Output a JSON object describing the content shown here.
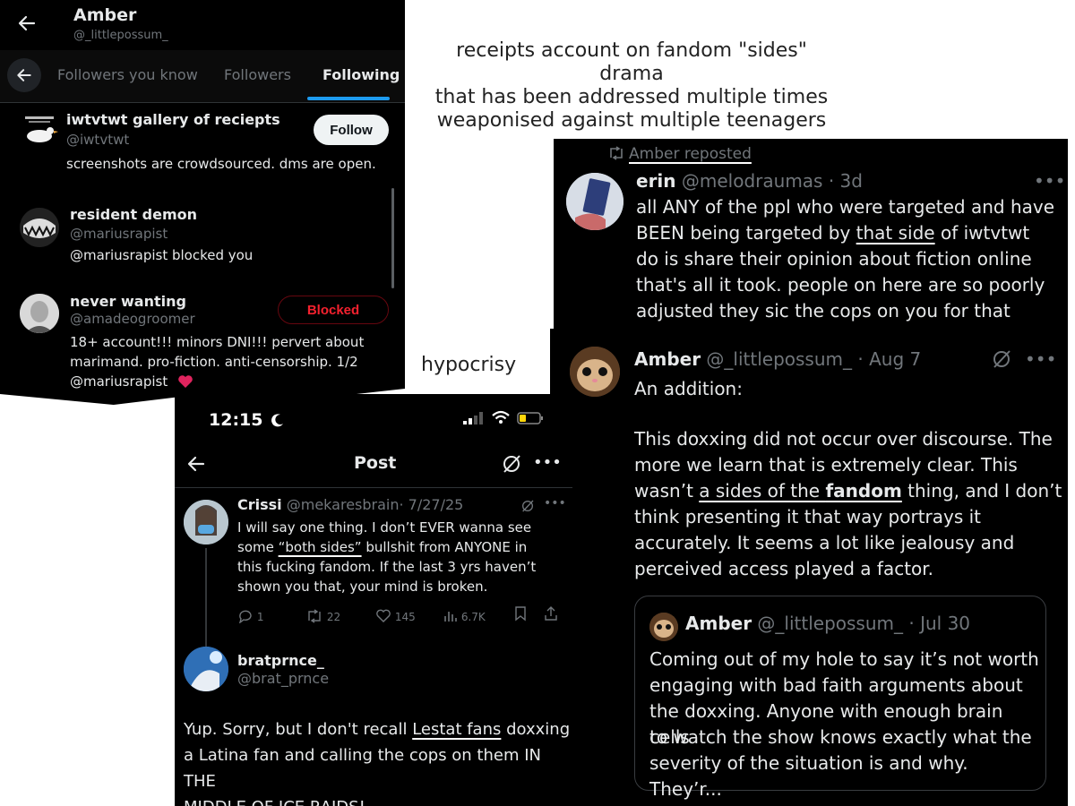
{
  "captions": {
    "top_lines": [
      "receipts account on fandom \"sides\" drama",
      "that has been addressed multiple times",
      "weaponised against multiple teenagers"
    ],
    "middle": "hypocrisy"
  },
  "following_panel": {
    "profile_name": "Amber",
    "profile_handle": "@_littlepossum_",
    "tabs": [
      "Followers you know",
      "Followers",
      "Following"
    ],
    "active_tab": "Following",
    "users": [
      {
        "name": "iwtvtwt gallery of reciepts",
        "handle": "@iwtvtwt",
        "bio": "screenshots are crowdsourced. dms are open.",
        "button": "Follow"
      },
      {
        "name": "resident demon",
        "handle": "@mariusrapist",
        "bio": "@mariusrapist blocked you",
        "button": ""
      },
      {
        "name": "never wanting",
        "handle": "@amadeogroomer",
        "bio_lines": [
          "18+ account!!! minors DNI!!! pervert about",
          "marimand. pro-fiction. anti-censorship. 1/2",
          "@mariusrapist"
        ],
        "button": "Blocked"
      }
    ]
  },
  "repost_panel": {
    "repost_label": "Amber reposted",
    "author": "erin",
    "handle": "@melodraumas",
    "time": "· 3d",
    "text_lines": [
      "all ANY of the ppl who were targeted and have",
      [
        "BEEN being targeted by ",
        "that side",
        " of iwtvtwt"
      ],
      "do is share their opinion about fiction online",
      "that's all it took. people on here are so poorly",
      "adjusted they sic the cops on you for that"
    ]
  },
  "amber_panel": {
    "author": "Amber",
    "handle": "@_littlepossum_",
    "time": "· Aug 7",
    "text_first": "An addition:",
    "text_lines": [
      "This doxxing did not occur over discourse. The",
      "more we learn that is extremely clear. This",
      [
        "wasn’t ",
        "a sides of the ",
        "fandom",
        " thing, and I don’t"
      ],
      "think presenting it that way portrays it",
      "accurately. It seems a lot like jealousy and",
      "perceived access played a factor."
    ],
    "quote": {
      "author": "Amber",
      "handle": "@_littlepossum_",
      "time": "· Jul 30",
      "text_lines": [
        "Coming out of my hole to say it’s not worth",
        "engaging with bad faith arguments about",
        "the doxxing. Anyone with enough brain cells",
        "to watch the show knows exactly what the",
        "severity of the situation is and why. They’r..."
      ]
    }
  },
  "post_panel": {
    "status_time": "12:15",
    "header_title": "Post",
    "post": {
      "author": "Crissi",
      "handle": "@mekaresbrain",
      "time": "· 7/27/25",
      "text_lines": [
        "I will say one thing. I don’t EVER wanna see",
        [
          "some ",
          "“both sides”",
          " bullshit from ANYONE in"
        ],
        "this fucking fandom. If the last 3 yrs haven’t",
        "shown you that, your mind is broken."
      ],
      "stats": {
        "replies": "1",
        "reposts": "22",
        "likes": "145",
        "views": "6.7K"
      }
    },
    "reply": {
      "author": "bratprnce_",
      "handle": "@brat_prnce",
      "text_lines": [
        [
          "Yup. Sorry, but I don't recall ",
          "Lestat fans",
          " doxxing"
        ],
        "a Latina fan and calling the cops on them IN THE",
        "MIDDLE OF ICE RAIDS!"
      ]
    }
  },
  "colors": {
    "background": "#000000",
    "text": "#e7e9ea",
    "muted": "#71767b",
    "accent_blue": "#1d9bf0",
    "blocked_red": "#f4212e"
  }
}
